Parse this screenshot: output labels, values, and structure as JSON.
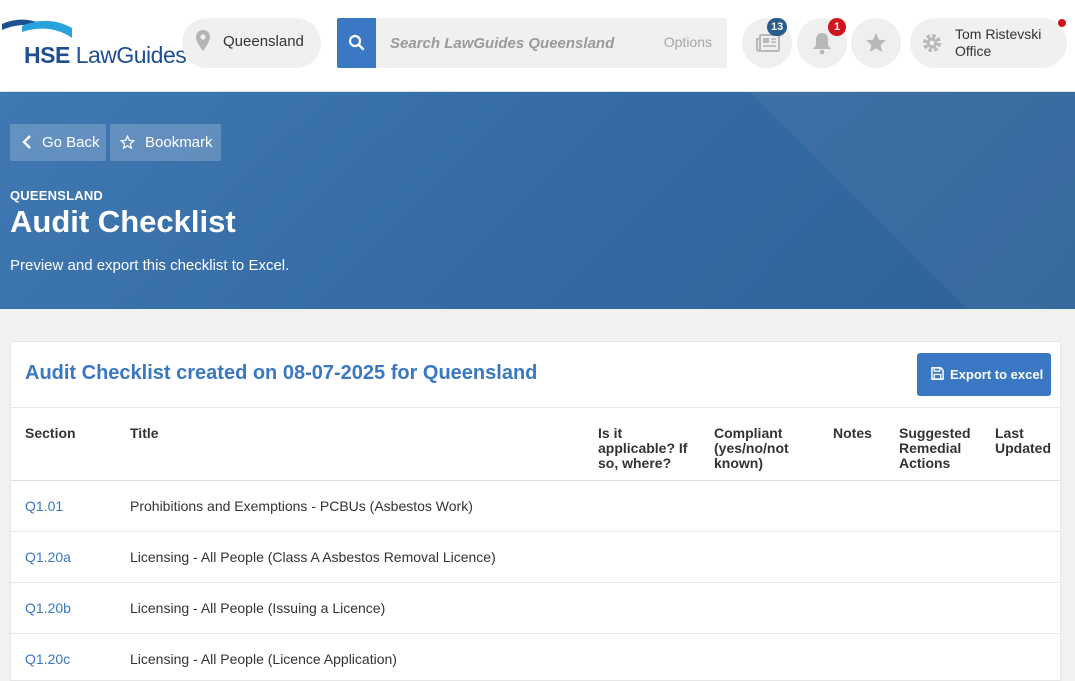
{
  "header": {
    "logo": {
      "brand": "HSE",
      "product": "LawGuides"
    },
    "location": "Queensland",
    "search": {
      "placeholder": "Search LawGuides Queensland",
      "options_label": "Options"
    },
    "news_count": "13",
    "notification_count": "1",
    "user": {
      "name": "Tom Ristevski",
      "org": "Office"
    }
  },
  "hero": {
    "back_label": "Go Back",
    "bookmark_label": "Bookmark",
    "kicker": "QUEENSLAND",
    "title": "Audit Checklist",
    "description": "Preview and export this checklist to Excel."
  },
  "card": {
    "title": "Audit Checklist created on 08-07-2025 for Queensland",
    "export_label": "Export to excel",
    "columns": [
      [
        "Section"
      ],
      [
        "Title"
      ],
      [
        "Is it",
        "applicable? If",
        "so, where?"
      ],
      [
        "Compliant",
        "(yes/no/not",
        "known)"
      ],
      [
        "Notes"
      ],
      [
        "Suggested",
        "Remedial",
        "Actions"
      ],
      [
        "Last",
        "Updated"
      ]
    ],
    "rows": [
      {
        "section": "Q1.01",
        "title": "Prohibitions and Exemptions - PCBUs (Asbestos Work)"
      },
      {
        "section": "Q1.20a",
        "title": "Licensing - All People (Class A Asbestos Removal Licence)"
      },
      {
        "section": "Q1.20b",
        "title": "Licensing - All People (Issuing a Licence)"
      },
      {
        "section": "Q1.20c",
        "title": "Licensing - All People (Licence Application)"
      }
    ]
  },
  "colors": {
    "accent": "#3a78c3",
    "hero": "#356ca6",
    "badge_blue": "#2a5b8c",
    "badge_red": "#d0161d"
  }
}
